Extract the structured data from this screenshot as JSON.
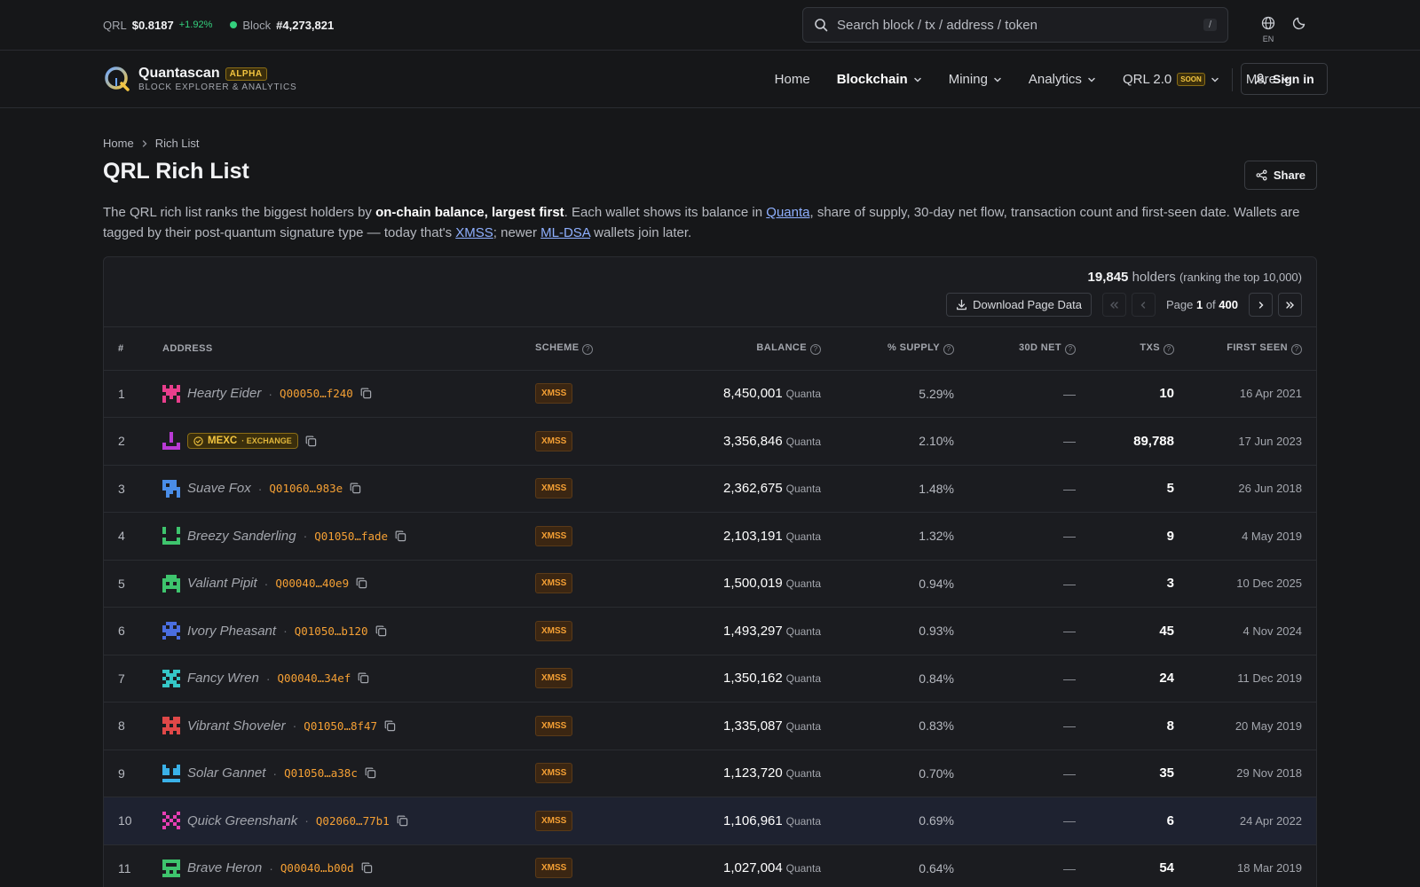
{
  "topbar": {
    "ticker_symbol": "QRL",
    "price": "$0.8187",
    "change": "+1.92%",
    "block_label": "Block",
    "block_height": "#4,273,821",
    "search_placeholder": "Search block / tx / address / token",
    "search_shortcut": "/",
    "lang": "EN"
  },
  "brand": {
    "name": "Quantascan",
    "badge": "ALPHA",
    "subtitle": "BLOCK EXPLORER & ANALYTICS"
  },
  "nav": {
    "home": "Home",
    "blockchain": "Blockchain",
    "mining": "Mining",
    "analytics": "Analytics",
    "qrl2": "QRL 2.0",
    "qrl2_badge": "SOON",
    "more": "More",
    "signin": "Sign in"
  },
  "breadcrumb": {
    "home": "Home",
    "current": "Rich List"
  },
  "page": {
    "title": "QRL Rich List",
    "share": "Share",
    "desc_1": "The QRL rich list ranks the biggest holders by ",
    "desc_bold": "on-chain balance, largest first",
    "desc_2": ". Each wallet shows its balance in ",
    "desc_link_quanta": "Quanta",
    "desc_3": ", share of supply, 30-day net flow, transaction count and first-seen date. Wallets are tagged by their post-quantum signature type — today that's ",
    "desc_link_xmss": "XMSS",
    "desc_4": "; newer ",
    "desc_link_mldsa": "ML-DSA",
    "desc_5": " wallets join later."
  },
  "summary": {
    "holders_count": "19,845",
    "holders_label": "holders",
    "ranking_note": "(ranking the top 10,000)",
    "download": "Download Page Data",
    "page_prefix": "Page",
    "page_current": "1",
    "page_of": "of",
    "page_total": "400"
  },
  "columns": {
    "rank": "#",
    "address": "ADDRESS",
    "scheme": "SCHEME",
    "balance": "BALANCE",
    "supply": "% SUPPLY",
    "net30d": "30D NET",
    "txs": "TXS",
    "first_seen": "FIRST SEEN"
  },
  "rows": [
    {
      "rank": "1",
      "name": "Hearty Eider",
      "hash": "Q00050…f240",
      "scheme": "XMSS",
      "balance": "8,450,001",
      "unit": "Quanta",
      "supply": "5.29%",
      "net": "—",
      "txs": "10",
      "first_seen": "16 Apr 2021",
      "avatar_color": "#e83e8c"
    },
    {
      "rank": "2",
      "exchange": "MEXC",
      "exchange_tag": "EXCHANGE",
      "scheme": "XMSS",
      "balance": "3,356,846",
      "unit": "Quanta",
      "supply": "2.10%",
      "net": "—",
      "txs": "89,788",
      "first_seen": "17 Jun 2023",
      "avatar_color": "#b93ad6"
    },
    {
      "rank": "3",
      "name": "Suave Fox",
      "hash": "Q01060…983e",
      "scheme": "XMSS",
      "balance": "2,362,675",
      "unit": "Quanta",
      "supply": "1.48%",
      "net": "—",
      "txs": "5",
      "first_seen": "26 Jun 2018",
      "avatar_color": "#4a8de8"
    },
    {
      "rank": "4",
      "name": "Breezy Sanderling",
      "hash": "Q01050…fade",
      "scheme": "XMSS",
      "balance": "2,103,191",
      "unit": "Quanta",
      "supply": "1.32%",
      "net": "—",
      "txs": "9",
      "first_seen": "4 May 2019",
      "avatar_color": "#3ec46d"
    },
    {
      "rank": "5",
      "name": "Valiant Pipit",
      "hash": "Q00040…40e9",
      "scheme": "XMSS",
      "balance": "1,500,019",
      "unit": "Quanta",
      "supply": "0.94%",
      "net": "—",
      "txs": "3",
      "first_seen": "10 Dec 2025",
      "avatar_color": "#3ec46d"
    },
    {
      "rank": "6",
      "name": "Ivory Pheasant",
      "hash": "Q01050…b120",
      "scheme": "XMSS",
      "balance": "1,493,297",
      "unit": "Quanta",
      "supply": "0.93%",
      "net": "—",
      "txs": "45",
      "first_seen": "4 Nov 2024",
      "avatar_color": "#4a6ee0"
    },
    {
      "rank": "7",
      "name": "Fancy Wren",
      "hash": "Q00040…34ef",
      "scheme": "XMSS",
      "balance": "1,350,162",
      "unit": "Quanta",
      "supply": "0.84%",
      "net": "—",
      "txs": "24",
      "first_seen": "11 Dec 2019",
      "avatar_color": "#35c7c7"
    },
    {
      "rank": "8",
      "name": "Vibrant Shoveler",
      "hash": "Q01050…8f47",
      "scheme": "XMSS",
      "balance": "1,335,087",
      "unit": "Quanta",
      "supply": "0.83%",
      "net": "—",
      "txs": "8",
      "first_seen": "20 May 2019",
      "avatar_color": "#e04848"
    },
    {
      "rank": "9",
      "name": "Solar Gannet",
      "hash": "Q01050…a38c",
      "scheme": "XMSS",
      "balance": "1,123,720",
      "unit": "Quanta",
      "supply": "0.70%",
      "net": "—",
      "txs": "35",
      "first_seen": "29 Nov 2018",
      "avatar_color": "#3ab1e8"
    },
    {
      "rank": "10",
      "name": "Quick Greenshank",
      "hash": "Q02060…77b1",
      "scheme": "XMSS",
      "balance": "1,106,961",
      "unit": "Quanta",
      "supply": "0.69%",
      "net": "—",
      "txs": "6",
      "first_seen": "24 Apr 2022",
      "avatar_color": "#e83eb4",
      "highlight": true
    },
    {
      "rank": "11",
      "name": "Brave Heron",
      "hash": "Q00040…b00d",
      "scheme": "XMSS",
      "balance": "1,027,004",
      "unit": "Quanta",
      "supply": "0.64%",
      "net": "—",
      "txs": "54",
      "first_seen": "18 Mar 2019",
      "avatar_color": "#3ec46d"
    }
  ]
}
